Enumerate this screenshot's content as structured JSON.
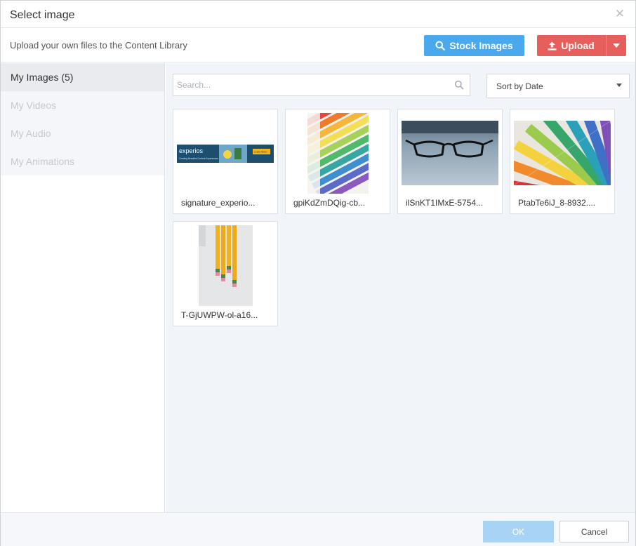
{
  "dialog": {
    "title": "Select image",
    "close_icon": "close-icon"
  },
  "toolbar": {
    "subtitle": "Upload your own files to the Content Library",
    "stock_label": "Stock Images",
    "stock_icon": "search-icon",
    "upload_label": "Upload",
    "upload_icon": "upload-icon",
    "upload_caret_icon": "caret-down-icon"
  },
  "sidebar": {
    "items": [
      {
        "label": "My Images (5)",
        "active": true
      },
      {
        "label": "My Videos",
        "active": false
      },
      {
        "label": "My Audio",
        "active": false
      },
      {
        "label": "My Animations",
        "active": false
      }
    ]
  },
  "library": {
    "search_placeholder": "Search...",
    "search_value": "",
    "sort_label": "Sort by Date",
    "images": [
      {
        "name": "signature_experio...",
        "thumbnail": "experios-banner"
      },
      {
        "name": "gpiKdZmDQig-cb...",
        "thumbnail": "rainbow-stacked-papers"
      },
      {
        "name": "ilSnKT1IMxE-5754...",
        "thumbnail": "eyeglasses-on-desk"
      },
      {
        "name": "PtabTe6iJ_8-8932....",
        "thumbnail": "color-swatch-fan"
      },
      {
        "name": "T-GjUWPW-ol-a16...",
        "thumbnail": "yellow-pencils"
      }
    ],
    "banner_logo": "experios",
    "banner_tagline": "Creating Beautiful Content Experiences",
    "banner_button": "Learn More"
  },
  "footer": {
    "ok_label": "OK",
    "cancel_label": "Cancel"
  },
  "colors": {
    "stock_button": "#4aa8ec",
    "upload_button": "#e65f5c",
    "ok_button_disabled": "#a9d3f5",
    "content_background": "#f1f4f8"
  }
}
